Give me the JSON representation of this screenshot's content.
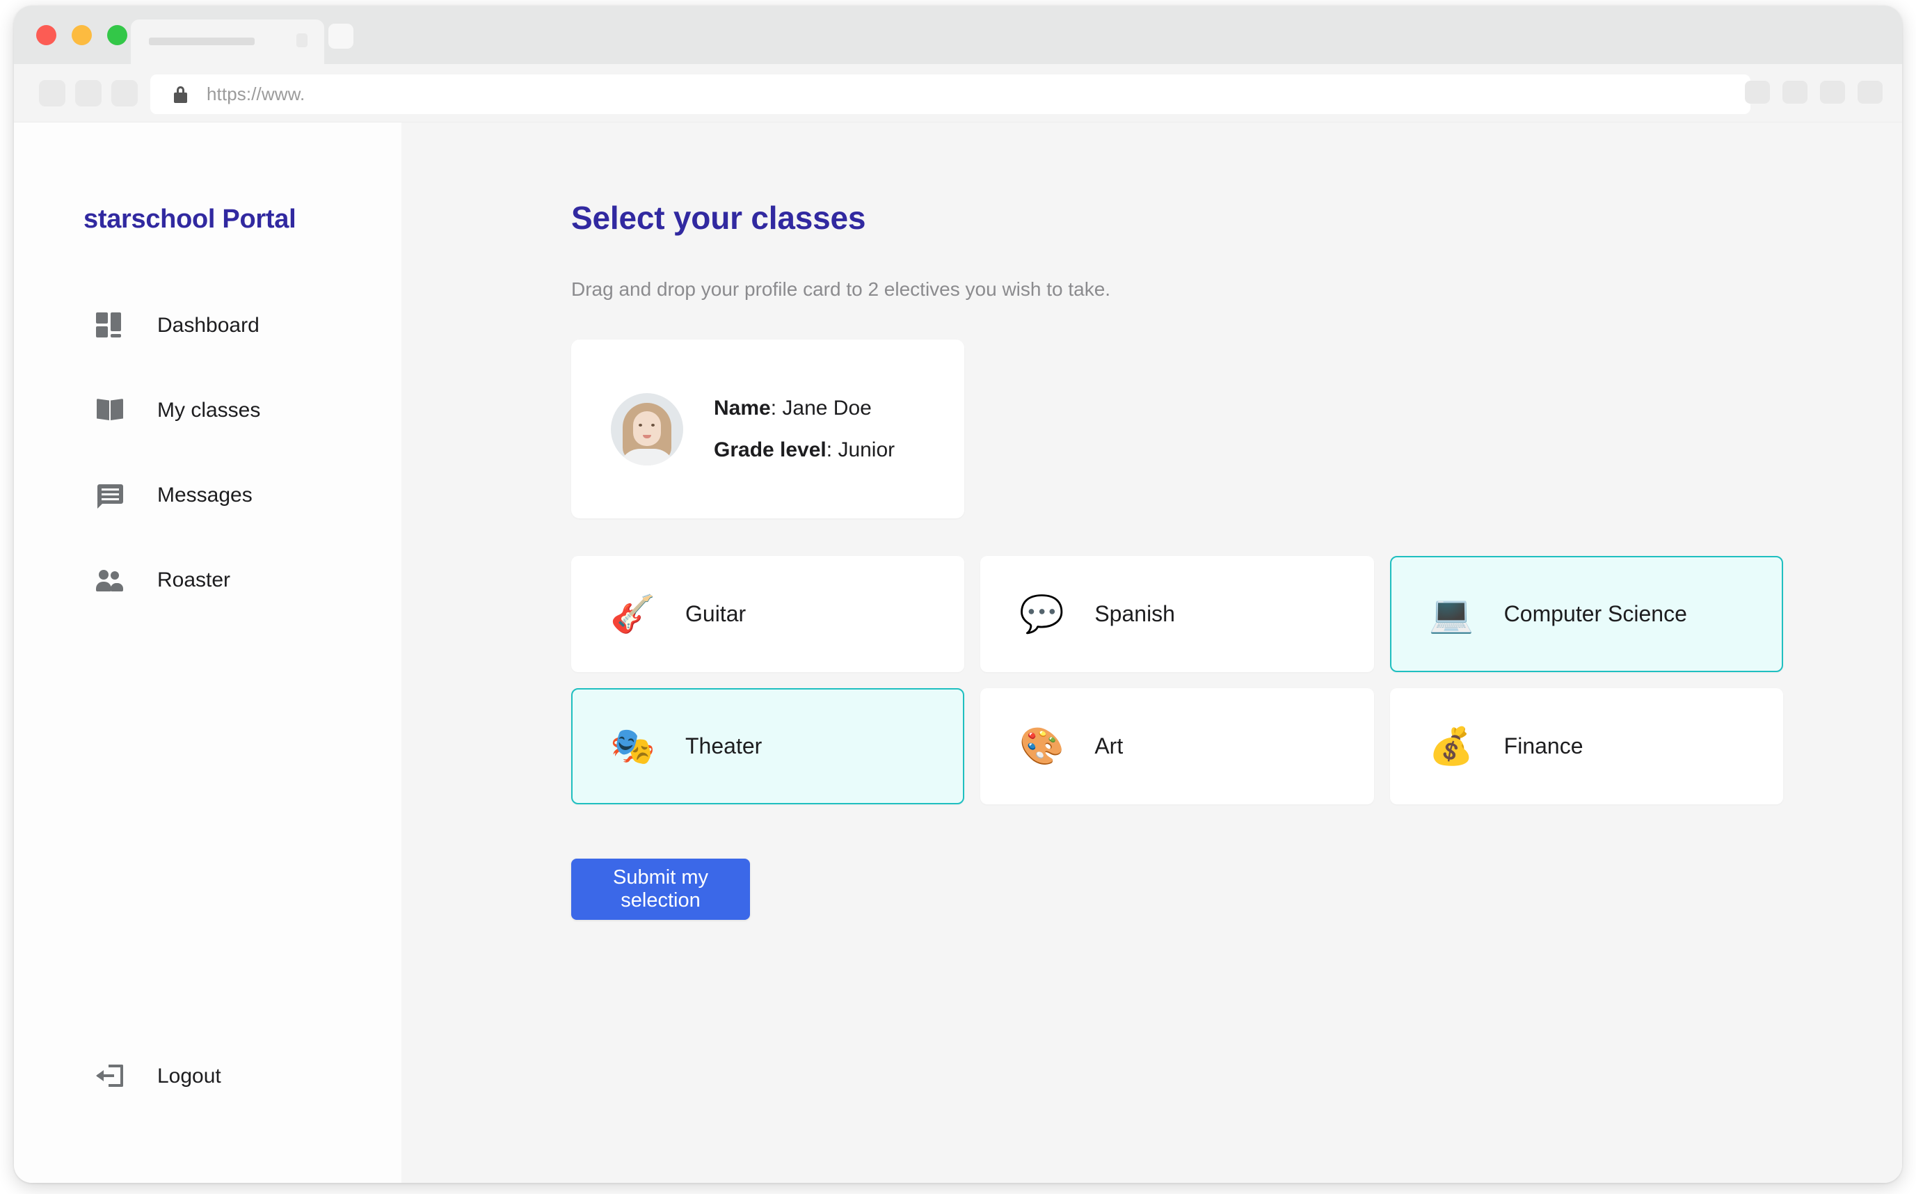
{
  "browser": {
    "url_placeholder": "https://www.",
    "lock_icon": "lock-icon",
    "traffic_lights": [
      "close-red",
      "minimize-yellow",
      "maximize-green"
    ],
    "nav_button_count": 3,
    "right_button_count": 4
  },
  "sidebar": {
    "brand": "starschool Portal",
    "items": [
      {
        "label": "Dashboard",
        "icon": "dashboard-grid-icon"
      },
      {
        "label": "My classes",
        "icon": "open-book-icon"
      },
      {
        "label": "Messages",
        "icon": "chat-bubble-icon"
      },
      {
        "label": "Roaster",
        "icon": "people-group-icon"
      }
    ],
    "logout": {
      "label": "Logout",
      "icon": "logout-arrow-icon"
    }
  },
  "main": {
    "title": "Select your classes",
    "subtitle": "Drag and drop your profile card to 2 electives you wish to take.",
    "profile": {
      "name_label": "Name",
      "name_value": "Jane Doe",
      "grade_label": "Grade level",
      "grade_value": "Junior",
      "avatar": "student-avatar"
    },
    "classes": [
      {
        "label": "Guitar",
        "emoji": "🎸",
        "icon": "guitar-icon",
        "selected": false
      },
      {
        "label": "Spanish",
        "emoji": "💬",
        "icon": "speech-bubble-icon",
        "selected": false
      },
      {
        "label": "Computer Science",
        "emoji": "💻",
        "icon": "laptop-icon",
        "selected": true
      },
      {
        "label": "Theater",
        "emoji": "🎭",
        "icon": "theater-masks-icon",
        "selected": true
      },
      {
        "label": "Art",
        "emoji": "🎨",
        "icon": "palette-icon",
        "selected": false
      },
      {
        "label": "Finance",
        "emoji": "💰",
        "icon": "money-bag-icon",
        "selected": false
      }
    ],
    "submit_label": "Submit my selection"
  },
  "colors": {
    "brand_indigo": "#3129a0",
    "selected_border": "#1fbfc0",
    "selected_background": "#e9fcfb",
    "submit_blue": "#3b68e8",
    "page_background": "#f5f5f5",
    "sidebar_background": "#fdfdfd"
  }
}
